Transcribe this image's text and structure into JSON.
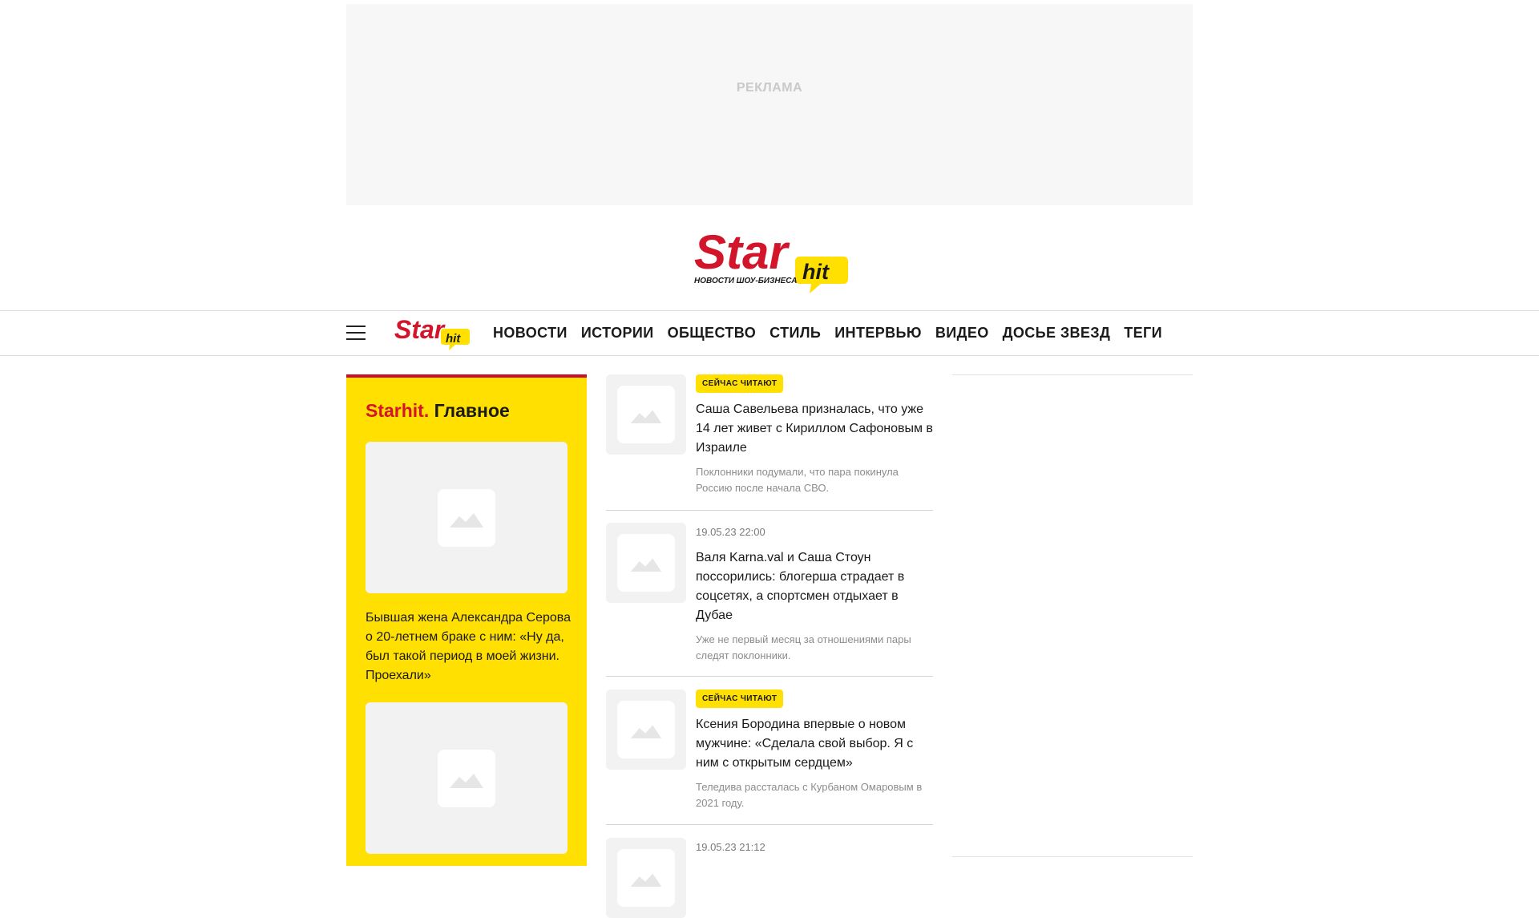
{
  "ad": {
    "label": "РЕКЛАМА"
  },
  "logo": {
    "star": "Star",
    "hit": "hit",
    "tagline": "НОВОСТИ ШОУ-БИЗНЕСА"
  },
  "nav": {
    "items": [
      {
        "label": "НОВОСТИ"
      },
      {
        "label": "ИСТОРИИ"
      },
      {
        "label": "ОБЩЕСТВО"
      },
      {
        "label": "СТИЛЬ"
      },
      {
        "label": "ИНТЕРВЬЮ"
      },
      {
        "label": "ВИДЕО"
      },
      {
        "label": "ДОСЬЕ ЗВЕЗД"
      },
      {
        "label": "ТЕГИ"
      }
    ]
  },
  "main": {
    "title_brand": "Starhit.",
    "title_rest": "Главное",
    "cards": [
      {
        "title": "Бывшая жена Александра Серова о 20-летнем браке с ним: «Ну да, был такой период в моей жизни. Проехали»"
      },
      {
        "title": ""
      }
    ]
  },
  "feed": {
    "items": [
      {
        "badge": "СЕЙЧАС ЧИТАЮТ",
        "title": "Саша Савельева призналась, что уже 14 лет живет с Кириллом Сафоновым в Израиле",
        "lead": "Поклонники подумали, что пара покинула Россию после начала СВО."
      },
      {
        "date": "19.05.23 22:00",
        "title": "Валя Karna.val и Саша Стоун поссорились: блогерша страдает в соцсетях, а спортсмен отдыхает в Дубае",
        "lead": "Уже не первый месяц за отношениями пары следят поклонники."
      },
      {
        "badge": "СЕЙЧАС ЧИТАЮТ",
        "title": "Ксения Бородина впервые о новом мужчине: «Сделала свой выбор. Я с ним с открытым сердцем»",
        "lead": "Теледива рассталась с Курбаном Омаровым в 2021 году."
      },
      {
        "date": "19.05.23 21:12"
      }
    ]
  },
  "colors": {
    "brand_red": "#d3152b",
    "brand_yellow": "#ffe000"
  },
  "icons": {
    "menu": "hamburger-icon",
    "placeholder": "image-placeholder-icon"
  }
}
